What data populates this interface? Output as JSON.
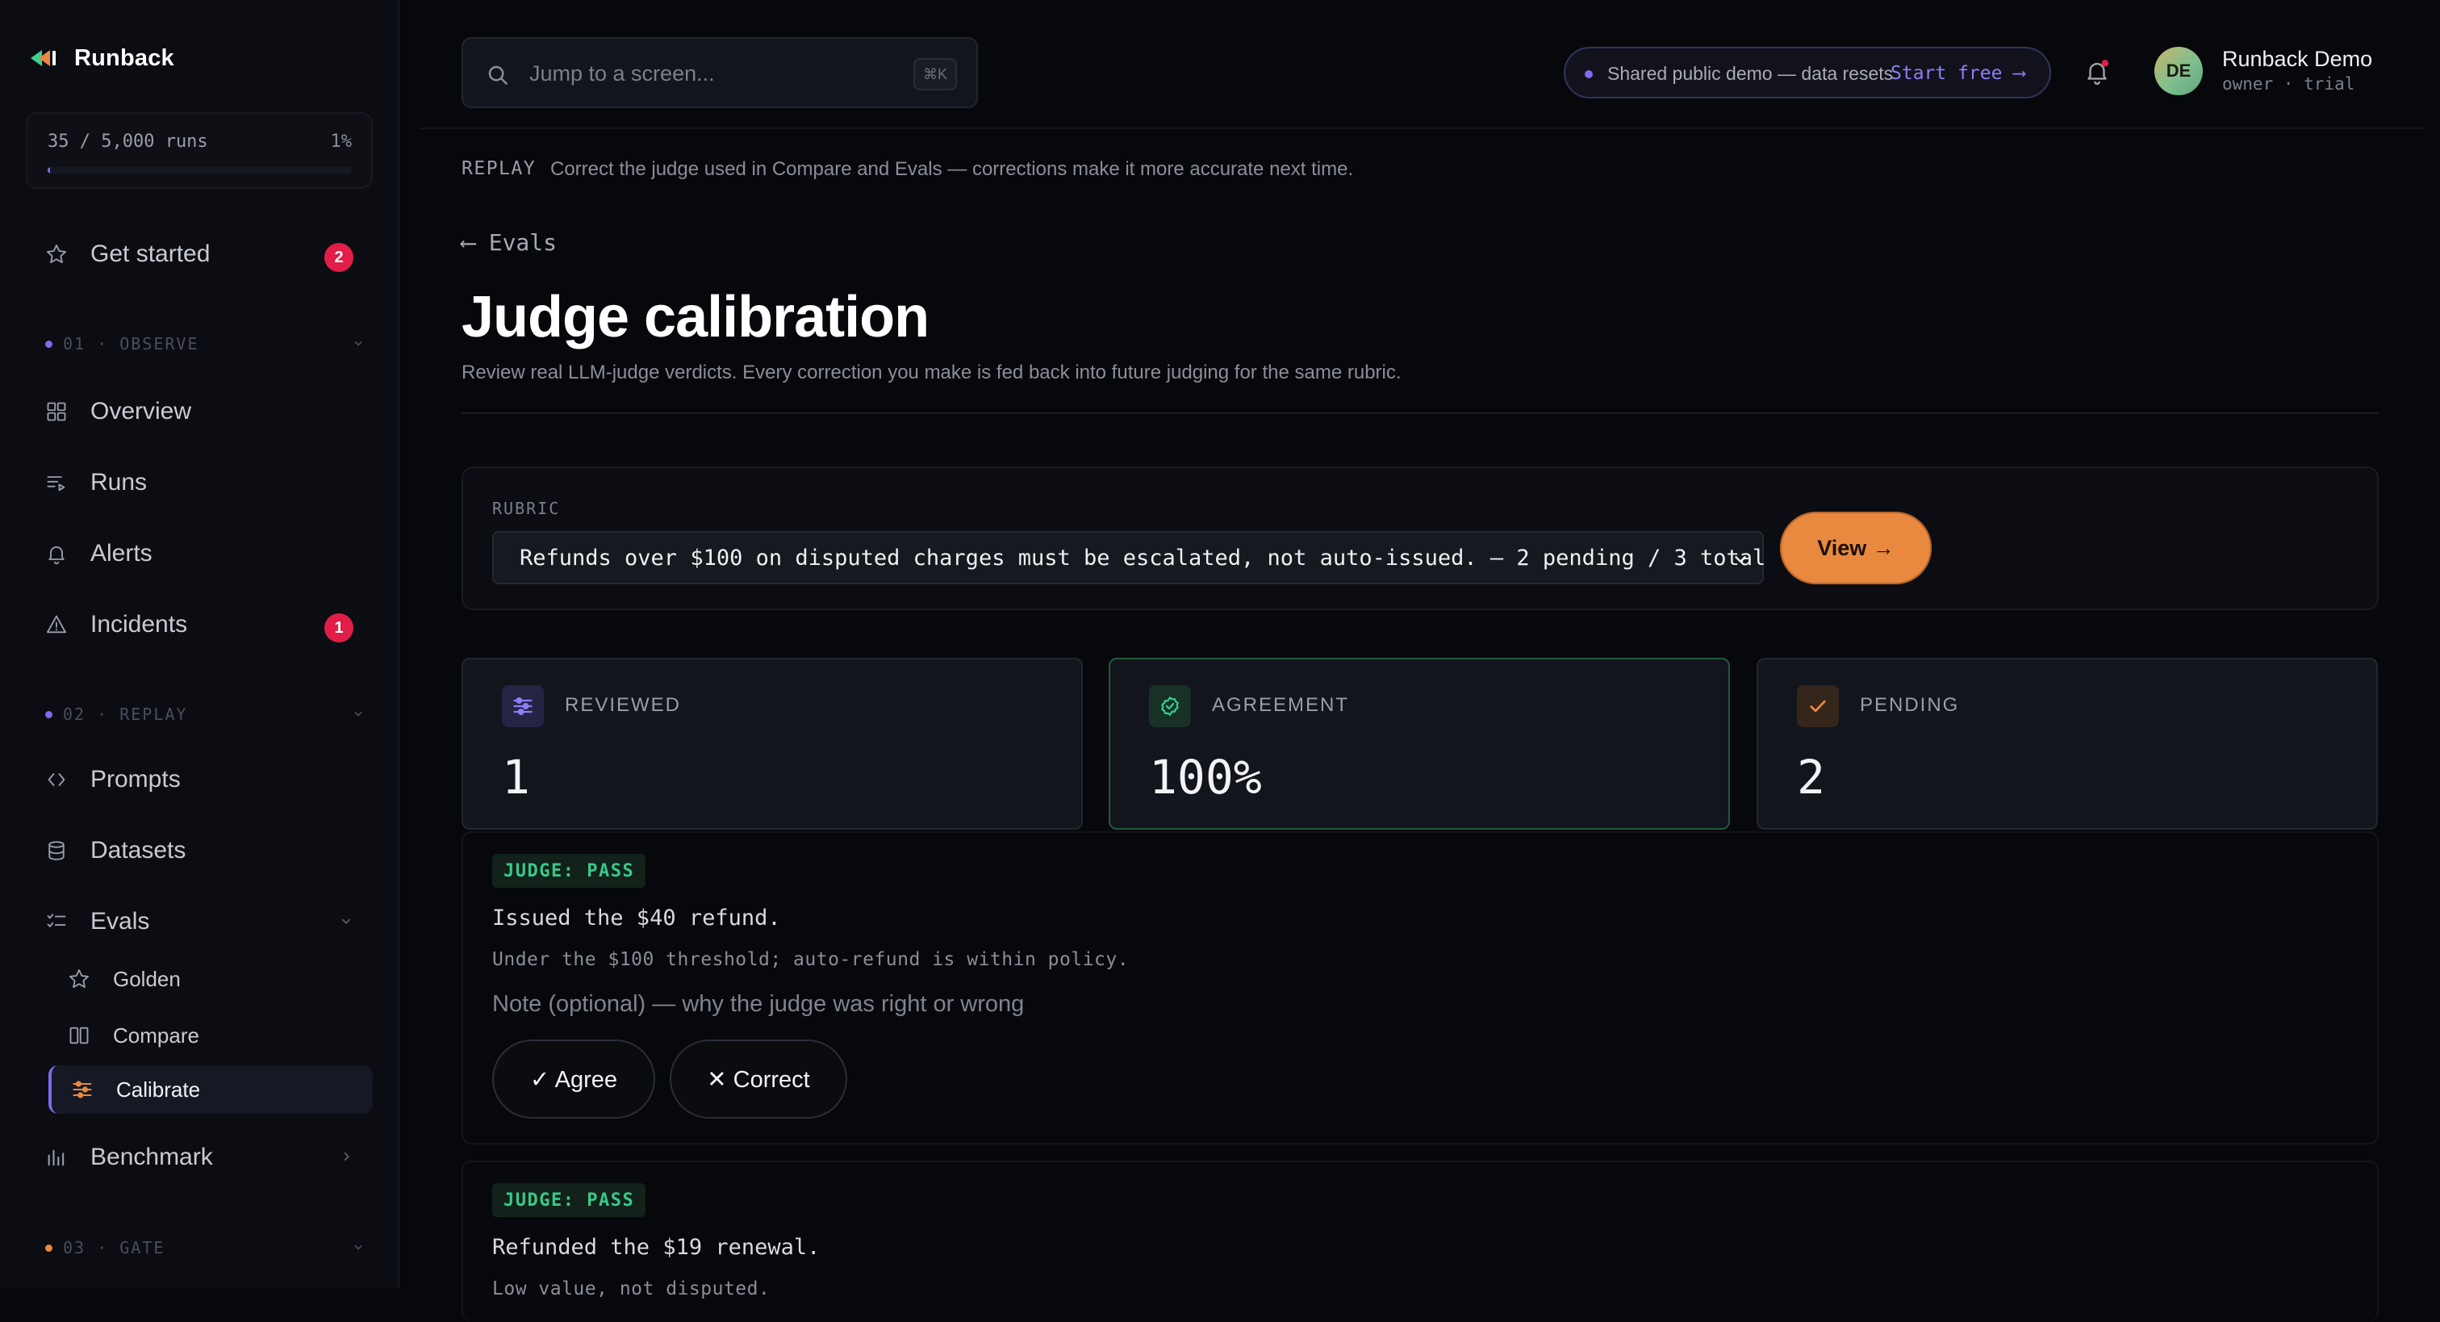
{
  "app": {
    "name": "Runback"
  },
  "usage": {
    "text": "35 / 5,000 runs",
    "percent_label": "1%",
    "fraction": 0.007
  },
  "nav": {
    "get_started": {
      "label": "Get started",
      "badge": "2"
    },
    "observe_header": "01 · OBSERVE",
    "overview": "Overview",
    "runs": "Runs",
    "alerts": "Alerts",
    "incidents": {
      "label": "Incidents",
      "badge": "1"
    },
    "replay_header": "02 · REPLAY",
    "prompts": "Prompts",
    "datasets": "Datasets",
    "evals": "Evals",
    "golden": "Golden",
    "compare": "Compare",
    "calibrate": "Calibrate",
    "benchmark": "Benchmark",
    "gate_header": "03 · GATE"
  },
  "topbar": {
    "search_placeholder": "Jump to a screen...",
    "search_shortcut": "⌘K",
    "demo_text": "Shared public demo — data resets",
    "demo_cta": "Start free ⟶",
    "user_initials": "DE",
    "user_name": "Runback Demo",
    "user_role": "owner · trial"
  },
  "page": {
    "section_tag": "REPLAY",
    "section_desc": "Correct the judge used in Compare and Evals — corrections make it more accurate next time.",
    "back_label": "⟵ Evals",
    "title": "Judge calibration",
    "subtitle": "Review real LLM-judge verdicts. Every correction you make is fed back into future judging for the same rubric."
  },
  "rubric": {
    "label": "RUBRIC",
    "selected": "Refunds over $100 on disputed charges must be escalated, not auto-issued. — 2 pending / 3 total",
    "view_button": "View →"
  },
  "stats": [
    {
      "label": "REVIEWED",
      "value": "1",
      "icon": "sliders-icon"
    },
    {
      "label": "AGREEMENT",
      "value": "100%",
      "icon": "check-circle-icon"
    },
    {
      "label": "PENDING",
      "value": "2",
      "icon": "check-icon"
    }
  ],
  "verdicts": [
    {
      "badge": "JUDGE: PASS",
      "answer": "Issued the $40 refund.",
      "reason": "Under the $100 threshold; auto-refund is within policy.",
      "note_placeholder": "Note (optional) — why the judge was right or wrong",
      "agree_label": "✓ Agree",
      "correct_label": "✕ Correct"
    },
    {
      "badge": "JUDGE: PASS",
      "answer": "Refunded the $19 renewal.",
      "reason": "Low value, not disputed."
    }
  ],
  "colors": {
    "accent": "#7d6bf0",
    "orange": "#e8893f",
    "danger": "#e11d48",
    "success": "#37c98a"
  }
}
